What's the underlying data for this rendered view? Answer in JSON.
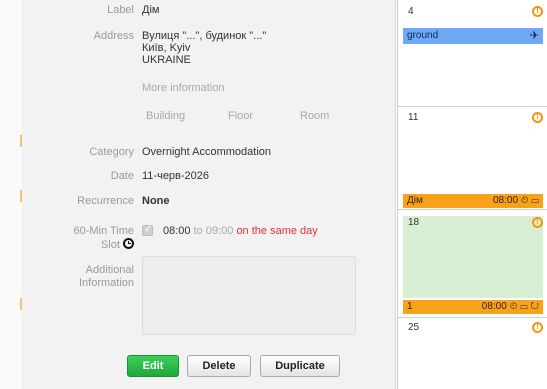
{
  "details": {
    "label": {
      "label": "Label",
      "value": "Дім"
    },
    "address": {
      "label": "Address",
      "line1": "Вулиця \"...\", будинок \"...\"",
      "line2": "Київ, Kyiv",
      "line3": "UKRAINE"
    },
    "more_information": "More information",
    "sub_fields": {
      "building": "Building",
      "floor": "Floor",
      "room": "Room"
    },
    "category": {
      "label": "Category",
      "value": "Overnight Accommodation"
    },
    "date": {
      "label": "Date",
      "value": "11-черв-2026"
    },
    "recurrence": {
      "label": "Recurrence",
      "value": "None"
    },
    "time_slot": {
      "label_line1": "60-Min Time",
      "label_line2": "Slot",
      "start": "08:00",
      "to": "to",
      "end": "09:00",
      "note": "on the same day",
      "checked": true
    },
    "additional_information": {
      "label_line1": "Additional",
      "label_line2": "Information",
      "value": ""
    }
  },
  "buttons": {
    "edit": "Edit",
    "delete": "Delete",
    "duplicate": "Duplicate"
  },
  "calendar": {
    "cells": [
      {
        "day": "4"
      },
      {
        "day": "11"
      },
      {
        "day": "18"
      },
      {
        "day": "25"
      }
    ],
    "events": [
      {
        "title": "ground",
        "icon": "airplane-icon",
        "color": "#6fa8f5"
      },
      {
        "title": "Дім",
        "time": "08:00",
        "color": "#f6a21a"
      },
      {
        "title": "1",
        "time": "08:00",
        "color": "#f6a21a"
      }
    ],
    "highlight_color": "#d9efd3",
    "warning_icon": "alert-circle-icon"
  }
}
